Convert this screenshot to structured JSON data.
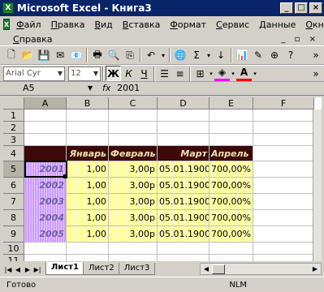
{
  "window": {
    "title": "Microsoft Excel - Книга3",
    "app_icon": "X"
  },
  "menu": [
    "Файл",
    "Правка",
    "Вид",
    "Вставка",
    "Формат",
    "Сервис",
    "Данные",
    "Окно"
  ],
  "menu2": {
    "help": "Справка"
  },
  "format_toolbar": {
    "font": "Arial Cyr",
    "size": "12"
  },
  "formula_bar": {
    "name_box": "A5",
    "fx": "fx",
    "value": "2001"
  },
  "columns": [
    "A",
    "B",
    "C",
    "D",
    "E",
    "F"
  ],
  "rows": [
    "1",
    "2",
    "3",
    "4",
    "5",
    "6",
    "7",
    "8",
    "9",
    "10",
    "11"
  ],
  "header_row": {
    "b": "Январь",
    "c": "Февраль",
    "d": "Март",
    "e": "Апрель"
  },
  "data_rows": [
    {
      "a": "2001",
      "b": "1,00",
      "c": "3,00р",
      "d": "05.01.1900",
      "e": "700,00%"
    },
    {
      "a": "2002",
      "b": "1,00",
      "c": "3,00р",
      "d": "05.01.1900",
      "e": "700,00%"
    },
    {
      "a": "2003",
      "b": "1,00",
      "c": "3,00р",
      "d": "05.01.1900",
      "e": "700,00%"
    },
    {
      "a": "2004",
      "b": "1,00",
      "c": "3,00р",
      "d": "05.01.1900",
      "e": "700,00%"
    },
    {
      "a": "2005",
      "b": "1,00",
      "c": "3,00р",
      "d": "05.01.1900",
      "e": "700,00%"
    }
  ],
  "sheets": [
    "Лист1",
    "Лист2",
    "Лист3"
  ],
  "status": {
    "text": "Готово",
    "nlm": "NLM"
  }
}
